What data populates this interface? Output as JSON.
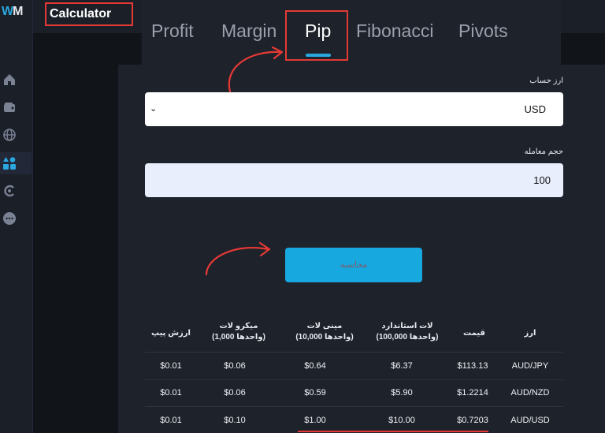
{
  "app": {
    "logo_w": "W",
    "logo_m": "M",
    "title": "Calculator"
  },
  "tabs": [
    {
      "label": "Profit"
    },
    {
      "label": "Margin"
    },
    {
      "label": "Pip"
    },
    {
      "label": "Fibonacci"
    },
    {
      "label": "Pivots"
    }
  ],
  "active_tab": "Pip",
  "form": {
    "currency_label": "ارز حساب",
    "currency_value": "USD",
    "volume_label": "حجم معامله",
    "volume_value": "100",
    "calculate_label": "محاسبه"
  },
  "table": {
    "headers": [
      {
        "key": "currency",
        "label": "ارز"
      },
      {
        "key": "price",
        "label": "قیمت"
      },
      {
        "key": "standard",
        "label": "لات استاندارد",
        "sub": "(واحدها 100,000)"
      },
      {
        "key": "mini",
        "label": "مینی لات",
        "sub": "(واحدها 10,000)"
      },
      {
        "key": "micro",
        "label": "میکرو لات",
        "sub": "(واحدها 1,000)"
      },
      {
        "key": "pip",
        "label": "ارزش پیپ"
      }
    ],
    "rows": [
      {
        "currency": "AUD/JPY",
        "price": "$113.13",
        "standard": "$6.37",
        "mini": "$0.64",
        "micro": "$0.06",
        "pip": "$0.01"
      },
      {
        "currency": "AUD/NZD",
        "price": "$1.2214",
        "standard": "$5.90",
        "mini": "$0.59",
        "micro": "$0.06",
        "pip": "$0.01"
      },
      {
        "currency": "AUD/USD",
        "price": "$0.7203",
        "standard": "$10.00",
        "mini": "$1.00",
        "micro": "$0.10",
        "pip": "$0.01"
      }
    ]
  },
  "colors": {
    "accent": "#29a8e0",
    "annotation": "#e53935",
    "button": "#17a8e0"
  },
  "rail_icons": [
    "home-icon",
    "wallet-icon",
    "globe-icon",
    "apps-icon",
    "copy-trade-icon",
    "more-icon"
  ]
}
